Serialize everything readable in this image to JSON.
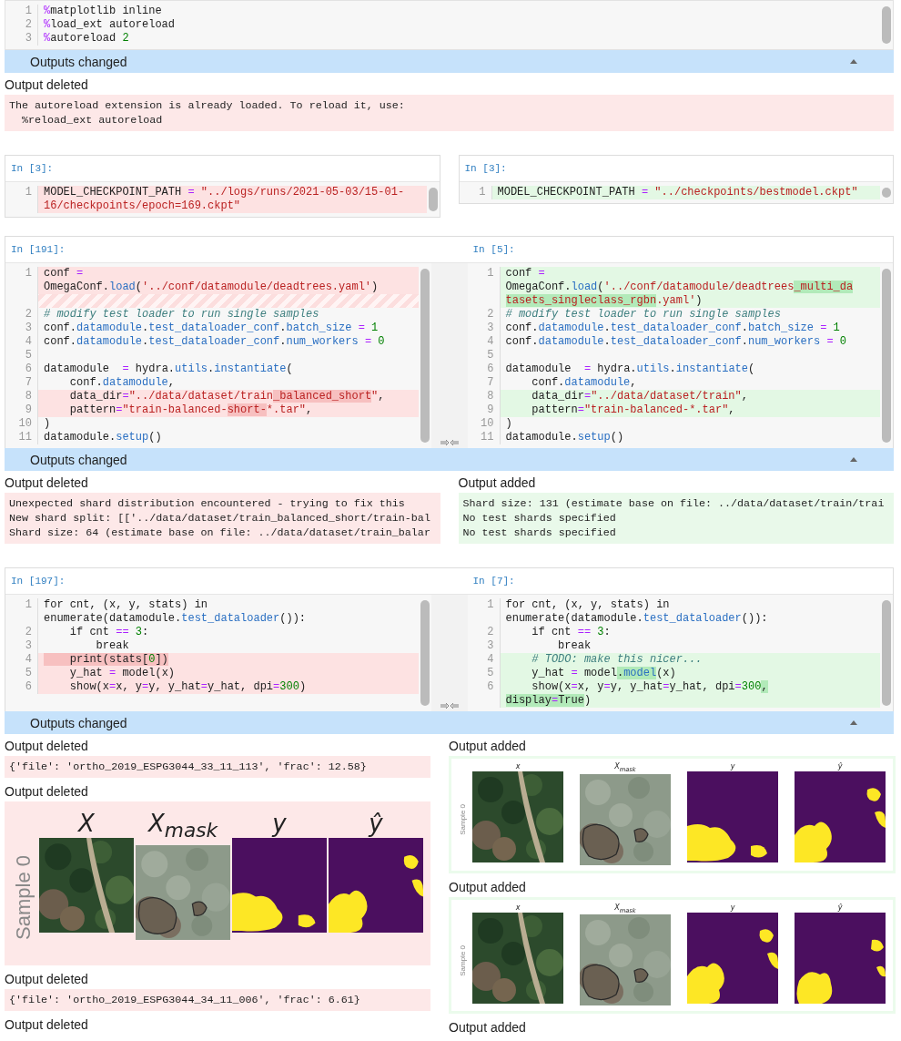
{
  "cells": [
    {
      "kind": "unchanged",
      "lines": [
        {
          "kind": "code",
          "n": "1",
          "rows": [
            "%matplotlib inline"
          ]
        },
        {
          "kind": "code",
          "n": "2",
          "rows": [
            "%load_ext autoreload"
          ]
        },
        {
          "kind": "code",
          "n": "3",
          "rows": [
            "%autoreload 2"
          ]
        }
      ],
      "outputs": {
        "header": "Outputs changed",
        "expanded": true,
        "left": [
          {
            "label": "Output deleted",
            "kind": "text",
            "lines": [
              "The autoreload extension is already loaded. To reload it, use:",
              "  %reload_ext autoreload"
            ]
          }
        ]
      }
    },
    {
      "kind": "split",
      "left": {
        "prompt": "In [3]:",
        "lines": [
          {
            "kind": "code",
            "n": "1",
            "changed": true,
            "rows": [
              "MODEL_CHECKPOINT_PATH = \"../logs/runs/2021-05-03/15-01-",
              "16/checkpoints/epoch=169.ckpt\""
            ]
          }
        ]
      },
      "right": {
        "prompt": "In [3]:",
        "lines": [
          {
            "kind": "code",
            "n": "1",
            "changed": true,
            "rows": [
              "MODEL_CHECKPOINT_PATH = \"../checkpoints/bestmodel.ckpt\""
            ]
          }
        ]
      }
    },
    {
      "kind": "modified",
      "left": {
        "prompt": "In [191]:",
        "lines": [
          {
            "kind": "code",
            "n": "1",
            "changed": true,
            "rows": [
              "conf =",
              "OmegaConf.load('../conf/datamodule/deadtrees.yaml')"
            ]
          },
          {
            "kind": "filler"
          },
          {
            "kind": "code",
            "n": "2",
            "changed": false,
            "rows": [
              "# modify test loader to run single samples"
            ]
          },
          {
            "kind": "code",
            "n": "3",
            "changed": false,
            "rows": [
              "conf.datamodule.test_dataloader_conf.batch_size = 1"
            ]
          },
          {
            "kind": "code",
            "n": "4",
            "changed": false,
            "rows": [
              "conf.datamodule.test_dataloader_conf.num_workers = 0"
            ]
          },
          {
            "kind": "code",
            "n": "5",
            "changed": false
          },
          {
            "kind": "code",
            "n": "6",
            "changed": false,
            "rows": [
              "datamodule  = hydra.utils.instantiate("
            ]
          },
          {
            "kind": "code",
            "n": "7",
            "changed": false,
            "rows": [
              "    conf.datamodule,"
            ]
          },
          {
            "kind": "code",
            "n": "8",
            "changed": true,
            "rows": [
              {
                "parts": [
                  {
                    "text": "    data_dir=\"../data/dataset/train",
                    "changed": false
                  },
                  {
                    "text": "_balanced_short",
                    "changed": true
                  },
                  {
                    "text": "\",",
                    "changed": false
                  }
                ]
              }
            ]
          },
          {
            "kind": "code",
            "n": "9",
            "changed": true,
            "rows": [
              {
                "parts": [
                  {
                    "text": "    pattern=\"train-balanced-",
                    "changed": false
                  },
                  {
                    "text": "short-",
                    "changed": true
                  },
                  {
                    "text": "*.tar\",",
                    "changed": false
                  }
                ]
              }
            ]
          },
          {
            "kind": "code",
            "n": "10",
            "changed": false,
            "rows": [
              ")"
            ]
          },
          {
            "kind": "code",
            "n": "11",
            "changed": false,
            "rows": [
              "datamodule.setup()"
            ]
          }
        ]
      },
      "right": {
        "prompt": "In [5]:",
        "lines": [
          {
            "kind": "code",
            "n": "1",
            "changed": true,
            "rows": [
              "conf =",
              {
                "parts": [
                  {
                    "text": "OmegaConf.load('../conf/datamodule/deadtrees",
                    "changed": false
                  },
                  {
                    "text": "_multi_da",
                    "changed": true
                  }
                ]
              },
              {
                "parts": [
                  {
                    "text": "tasets_singleclass_rgbn",
                    "changed": true
                  },
                  {
                    "text": ".yaml')",
                    "changed": false
                  }
                ]
              }
            ]
          },
          {
            "kind": "code",
            "n": "2",
            "changed": false,
            "rows": [
              "# modify test loader to run single samples"
            ]
          },
          {
            "kind": "code",
            "n": "3",
            "changed": false,
            "rows": [
              "conf.datamodule.test_dataloader_conf.batch_size = 1"
            ]
          },
          {
            "kind": "code",
            "n": "4",
            "changed": false,
            "rows": [
              "conf.datamodule.test_dataloader_conf.num_workers = 0"
            ]
          },
          {
            "kind": "code",
            "n": "5",
            "changed": false
          },
          {
            "kind": "code",
            "n": "6",
            "changed": false,
            "rows": [
              "datamodule  = hydra.utils.instantiate("
            ]
          },
          {
            "kind": "code",
            "n": "7",
            "changed": false,
            "rows": [
              "    conf.datamodule,"
            ]
          },
          {
            "kind": "code",
            "n": "8",
            "changed": true,
            "rows": [
              "    data_dir=\"../data/dataset/train\","
            ]
          },
          {
            "kind": "code",
            "n": "9",
            "changed": true,
            "rows": [
              "    pattern=\"train-balanced-*.tar\","
            ]
          },
          {
            "kind": "code",
            "n": "10",
            "changed": false,
            "rows": [
              ")"
            ]
          },
          {
            "kind": "code",
            "n": "11",
            "changed": false,
            "rows": [
              "datamodule.setup()"
            ]
          }
        ]
      },
      "outputs": {
        "header": "Outputs changed",
        "expanded": true,
        "left": [
          {
            "label": "Output deleted",
            "kind": "text",
            "lines": [
              "Unexpected shard distribution encountered - trying to fix this",
              "New shard split: [['../data/dataset/train_balanced_short/train-bal",
              "Shard size: 64 (estimate base on file: ../data/dataset/train_balar"
            ]
          }
        ],
        "right": [
          {
            "label": "Output added",
            "kind": "text",
            "lines": [
              "Shard size: 131 (estimate base on file: ../data/dataset/train/trai",
              "No test shards specified",
              "No test shards specified"
            ]
          }
        ]
      }
    },
    {
      "kind": "modified",
      "left": {
        "prompt": "In [197]:",
        "lines": [
          {
            "kind": "code",
            "n": "1",
            "changed": false,
            "rows": [
              "for cnt, (x, y, stats) in",
              "enumerate(datamodule.test_dataloader()):"
            ]
          },
          {
            "kind": "code",
            "n": "2",
            "changed": false,
            "rows": [
              "    if cnt == 3:"
            ]
          },
          {
            "kind": "code",
            "n": "3",
            "changed": false,
            "rows": [
              "        break"
            ]
          },
          {
            "kind": "code",
            "n": "4",
            "changed": true,
            "rows": [
              {
                "parts": [
                  {
                    "text": "    print(stats[0])",
                    "changed": true
                  }
                ]
              }
            ]
          },
          {
            "kind": "code",
            "n": "5",
            "changed": true,
            "rows": [
              "    y_hat = model(x)"
            ]
          },
          {
            "kind": "code",
            "n": "6",
            "changed": true,
            "rows": [
              "    show(x=x, y=y, y_hat=y_hat, dpi=300)"
            ]
          }
        ]
      },
      "right": {
        "prompt": "In [7]:",
        "lines": [
          {
            "kind": "code",
            "n": "1",
            "changed": false,
            "rows": [
              "for cnt, (x, y, stats) in",
              "enumerate(datamodule.test_dataloader()):"
            ]
          },
          {
            "kind": "code",
            "n": "2",
            "changed": false,
            "rows": [
              "    if cnt == 3:"
            ]
          },
          {
            "kind": "code",
            "n": "3",
            "changed": false,
            "rows": [
              "        break"
            ]
          },
          {
            "kind": "code",
            "n": "4",
            "changed": true,
            "rows": [
              "    # TODO: make this nicer..."
            ]
          },
          {
            "kind": "code",
            "n": "5",
            "changed": true,
            "rows": [
              {
                "parts": [
                  {
                    "text": "    y_hat = model",
                    "changed": false
                  },
                  {
                    "text": ".model",
                    "changed": true
                  },
                  {
                    "text": "(x)",
                    "changed": false
                  }
                ]
              }
            ]
          },
          {
            "kind": "code",
            "n": "6",
            "changed": true,
            "rows": [
              {
                "parts": [
                  {
                    "text": "    show(x=x, y=y, y_hat=y_hat, dpi=300",
                    "changed": false
                  },
                  {
                    "text": ",",
                    "changed": true
                  }
                ]
              },
              {
                "parts": [
                  {
                    "text": "display=True",
                    "changed": true
                  },
                  {
                    "text": ")",
                    "changed": false
                  }
                ]
              }
            ]
          }
        ]
      },
      "outputs": {
        "header": "Outputs changed",
        "expanded": true,
        "left": [
          {
            "label": "Output deleted",
            "kind": "text",
            "lines": [
              "{'file': 'ortho_2019_ESPG3044_33_11_113', 'frac': 12.58}"
            ]
          },
          {
            "label": "Output deleted",
            "kind": "large_figure",
            "ylabel": "Sample 0",
            "panels": [
              {
                "title": "X"
              },
              {
                "title": "X$_{mask}$",
                "kind": "masked"
              },
              {
                "title": "y",
                "kind": "mask"
              },
              {
                "title": "ŷ",
                "kind": "mask"
              }
            ]
          },
          {
            "label": "Output deleted",
            "kind": "text",
            "lines": [
              "{'file': 'ortho_2019_ESPG3044_34_11_006', 'frac': 6.61}"
            ]
          },
          {
            "label": "Output deleted"
          }
        ],
        "right": [
          {
            "label": "Output added",
            "kind": "small_figure",
            "ylabel": "Sample 0",
            "panels": [
              {
                "title": "x"
              },
              {
                "title": "X$_{mask}$",
                "kind": "masked"
              },
              {
                "title": "y",
                "kind": "mask"
              },
              {
                "title": "ŷ",
                "kind": "mask"
              }
            ]
          },
          {
            "label": "Output added",
            "kind": "small_figure",
            "ylabel": "Sample 0",
            "panels": [
              {
                "title": "x"
              },
              {
                "title": "X$_{mask}$",
                "kind": "masked"
              },
              {
                "title": "y",
                "kind": "mask"
              },
              {
                "title": "ŷ",
                "kind": "mask"
              }
            ]
          },
          {
            "label": "Output added"
          }
        ]
      }
    }
  ]
}
